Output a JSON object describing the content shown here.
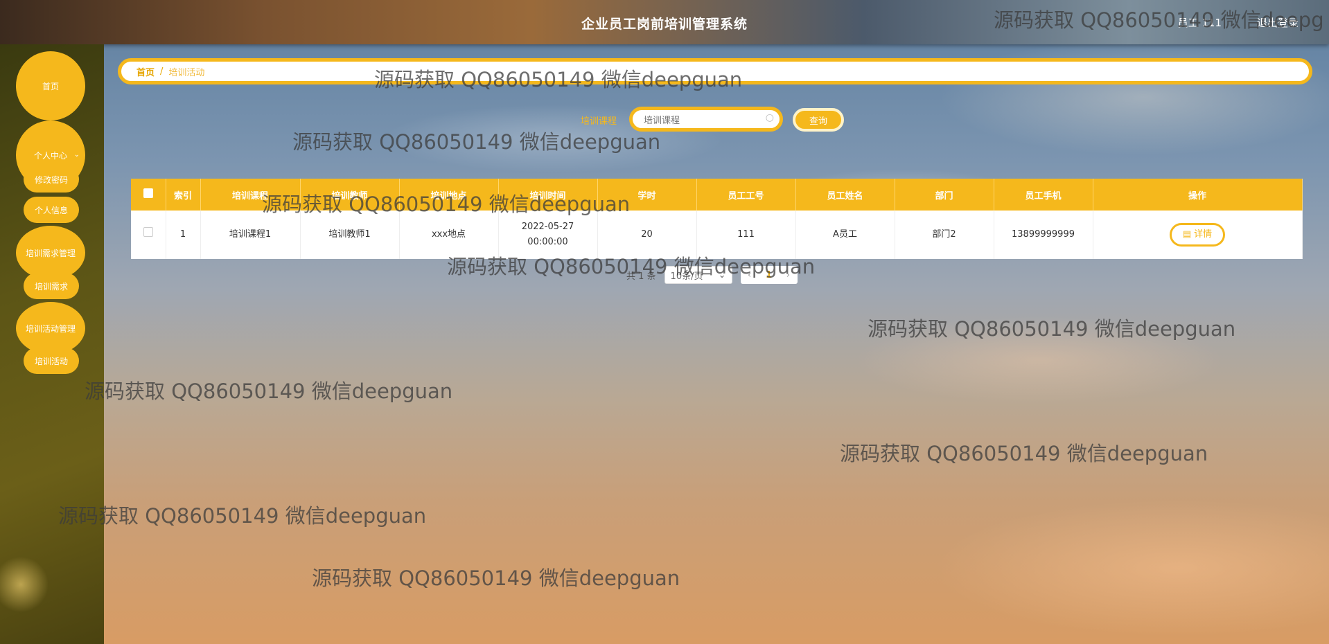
{
  "app": {
    "title": "企业员工岗前培训管理系统"
  },
  "header": {
    "user": "员工 111",
    "logout": "退出登录"
  },
  "sidebar": {
    "home": "首页",
    "personal_center": "个人中心",
    "change_password": "修改密码",
    "personal_info": "个人信息",
    "demand_management": "培训需求管理",
    "demand": "培训需求",
    "activity_management": "培训活动管理",
    "activity": "培训活动"
  },
  "breadcrumb": {
    "home": "首页",
    "separator": "/",
    "current": "培训活动"
  },
  "search": {
    "label": "培训课程",
    "placeholder": "培训课程",
    "button": "查询"
  },
  "table": {
    "columns": [
      "索引",
      "培训课程",
      "培训教师",
      "培训地点",
      "培训时间",
      "学时",
      "员工工号",
      "员工姓名",
      "部门",
      "员工手机",
      "操作"
    ],
    "rows": [
      {
        "index": "1",
        "course": "培训课程1",
        "teacher": "培训教师1",
        "location": "xxx地点",
        "time": "2022-05-27 00:00:00",
        "hours": "20",
        "emp_no": "111",
        "emp_name": "A员工",
        "dept": "部门2",
        "phone": "13899999999",
        "action": "详情"
      }
    ]
  },
  "pagination": {
    "total": "共 1 条",
    "page_size": "10条/页",
    "current_page": "1"
  },
  "watermark": "源码获取 QQ86050149 微信deepguan",
  "watermark_cut": "源码获取 QQ86050149 微信deepg",
  "colors": {
    "accent": "#f5b81c"
  }
}
